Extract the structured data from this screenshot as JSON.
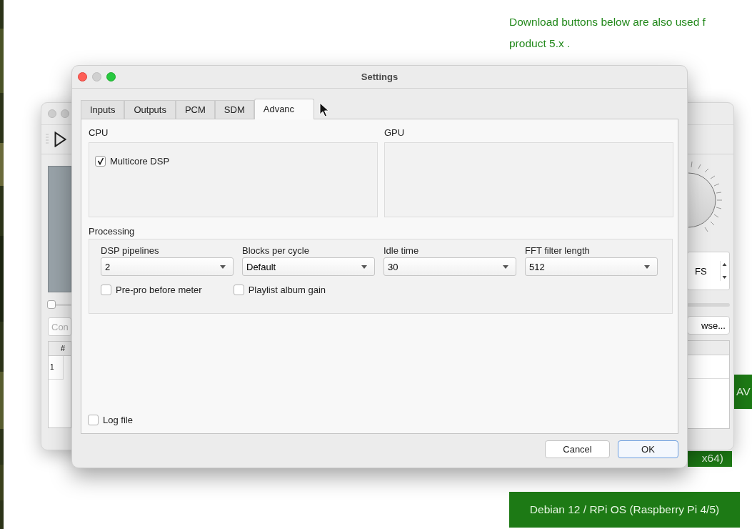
{
  "page_note": {
    "lines": [
      "Download buttons below are also used f",
      "product 5.x ."
    ]
  },
  "download_buttons": [
    {
      "label": "AV",
      "kind": "side"
    },
    {
      "label": "x64)",
      "kind": "side"
    },
    {
      "label": "Debian 12 / RPi OS (Raspberry Pi 4/5)",
      "kind": "full"
    }
  ],
  "back_window": {
    "field_placeholder": "Con",
    "table_header": "#",
    "row_number": "1",
    "spin_value": "FS",
    "browse_button": "wse..."
  },
  "settings": {
    "title": "Settings",
    "tabs": [
      {
        "label": "Inputs",
        "selected": false
      },
      {
        "label": "Outputs",
        "selected": false
      },
      {
        "label": "PCM",
        "selected": false
      },
      {
        "label": "SDM",
        "selected": false
      },
      {
        "label": "Advanc",
        "selected": true
      }
    ],
    "cpu": {
      "label": "CPU",
      "options": [
        {
          "label": "Multicore DSP",
          "checked": true
        }
      ]
    },
    "gpu": {
      "label": "GPU"
    },
    "processing": {
      "label": "Processing",
      "combos": [
        {
          "label": "DSP pipelines",
          "value": "2"
        },
        {
          "label": "Blocks per cycle",
          "value": "Default"
        },
        {
          "label": "Idle time",
          "value": "30"
        },
        {
          "label": "FFT filter length",
          "value": "512"
        }
      ],
      "options": [
        {
          "label": "Pre-pro before meter",
          "checked": false
        },
        {
          "label": "Playlist album gain",
          "checked": false
        }
      ]
    },
    "log_file": {
      "label": "Log file",
      "checked": false
    },
    "buttons": [
      {
        "label": "Cancel",
        "default": false
      },
      {
        "label": "OK",
        "default": true
      }
    ]
  }
}
